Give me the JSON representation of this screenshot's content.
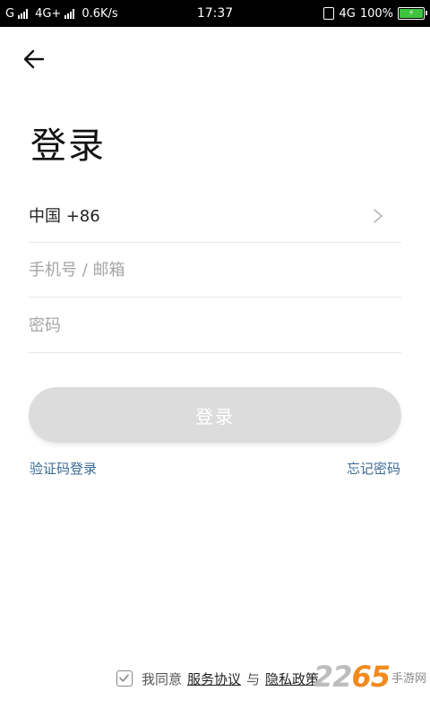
{
  "statusbar": {
    "carrier1": "G",
    "network2": "4G+",
    "speed": "0.6K/s",
    "time": "17:37",
    "network_right": "4G",
    "battery_pct": "100%",
    "battery_level": 1.0
  },
  "header": {
    "back_icon": "arrow-left-icon",
    "title": "登录"
  },
  "form": {
    "country_code": "中国 +86",
    "phone_placeholder": "手机号 / 邮箱",
    "phone_value": "",
    "password_placeholder": "密码",
    "password_value": ""
  },
  "actions": {
    "login_label": "登录",
    "sms_login": "验证码登录",
    "forgot_password": "忘记密码"
  },
  "agreement": {
    "prefix": "我同意",
    "terms": "服务协议",
    "conjunction": "与",
    "privacy": "隐私政策"
  },
  "watermark": {
    "brand_digits": "2265",
    "brand_text": "手游网"
  },
  "colors": {
    "link": "#3b6b99",
    "button_disabled": "#dcdcdc",
    "battery": "#3ec43e",
    "watermark_accent": "#f28a1e"
  }
}
